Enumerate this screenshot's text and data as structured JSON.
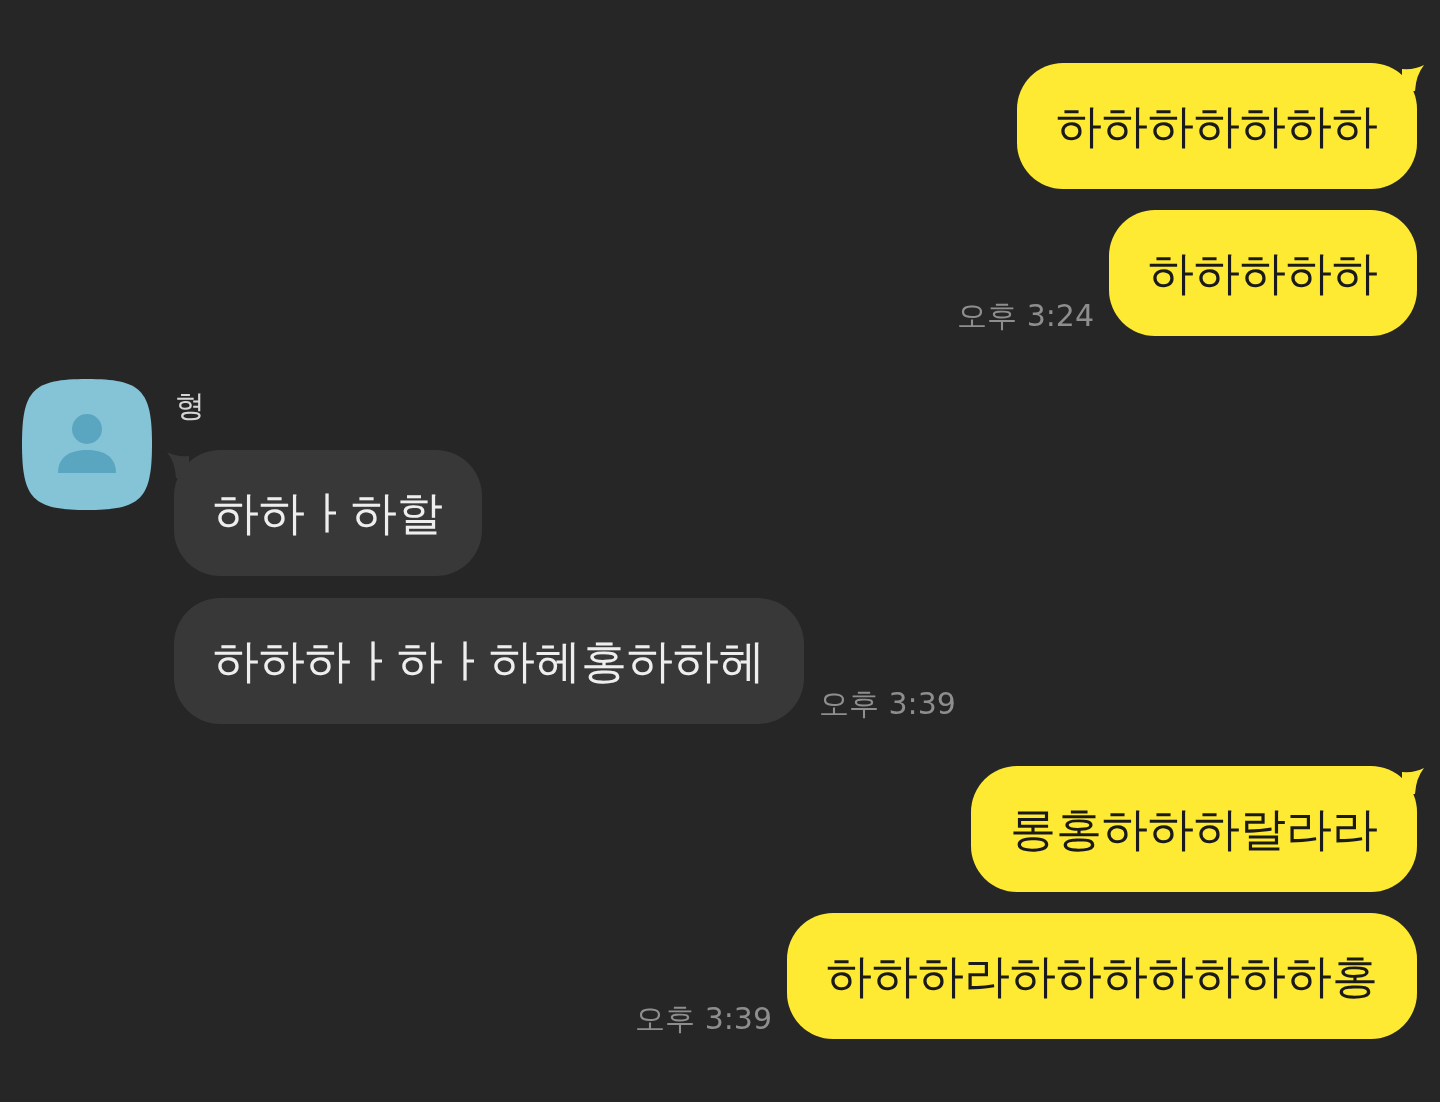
{
  "messages": [
    {
      "kind": "sent",
      "bubbles": [
        "하하하하하하하",
        "하하하하하"
      ],
      "time": "오후 3:24"
    },
    {
      "kind": "received",
      "sender": "형",
      "bubbles": [
        "하하ㅏ하할",
        "하하하ㅏ하ㅏ하헤홍하하헤"
      ],
      "time": "오후 3:39"
    },
    {
      "kind": "sent",
      "bubbles": [
        "롱홍하하하랄라라",
        "하하하라하하하하하하하홍"
      ],
      "time": "오후 3:39"
    }
  ]
}
